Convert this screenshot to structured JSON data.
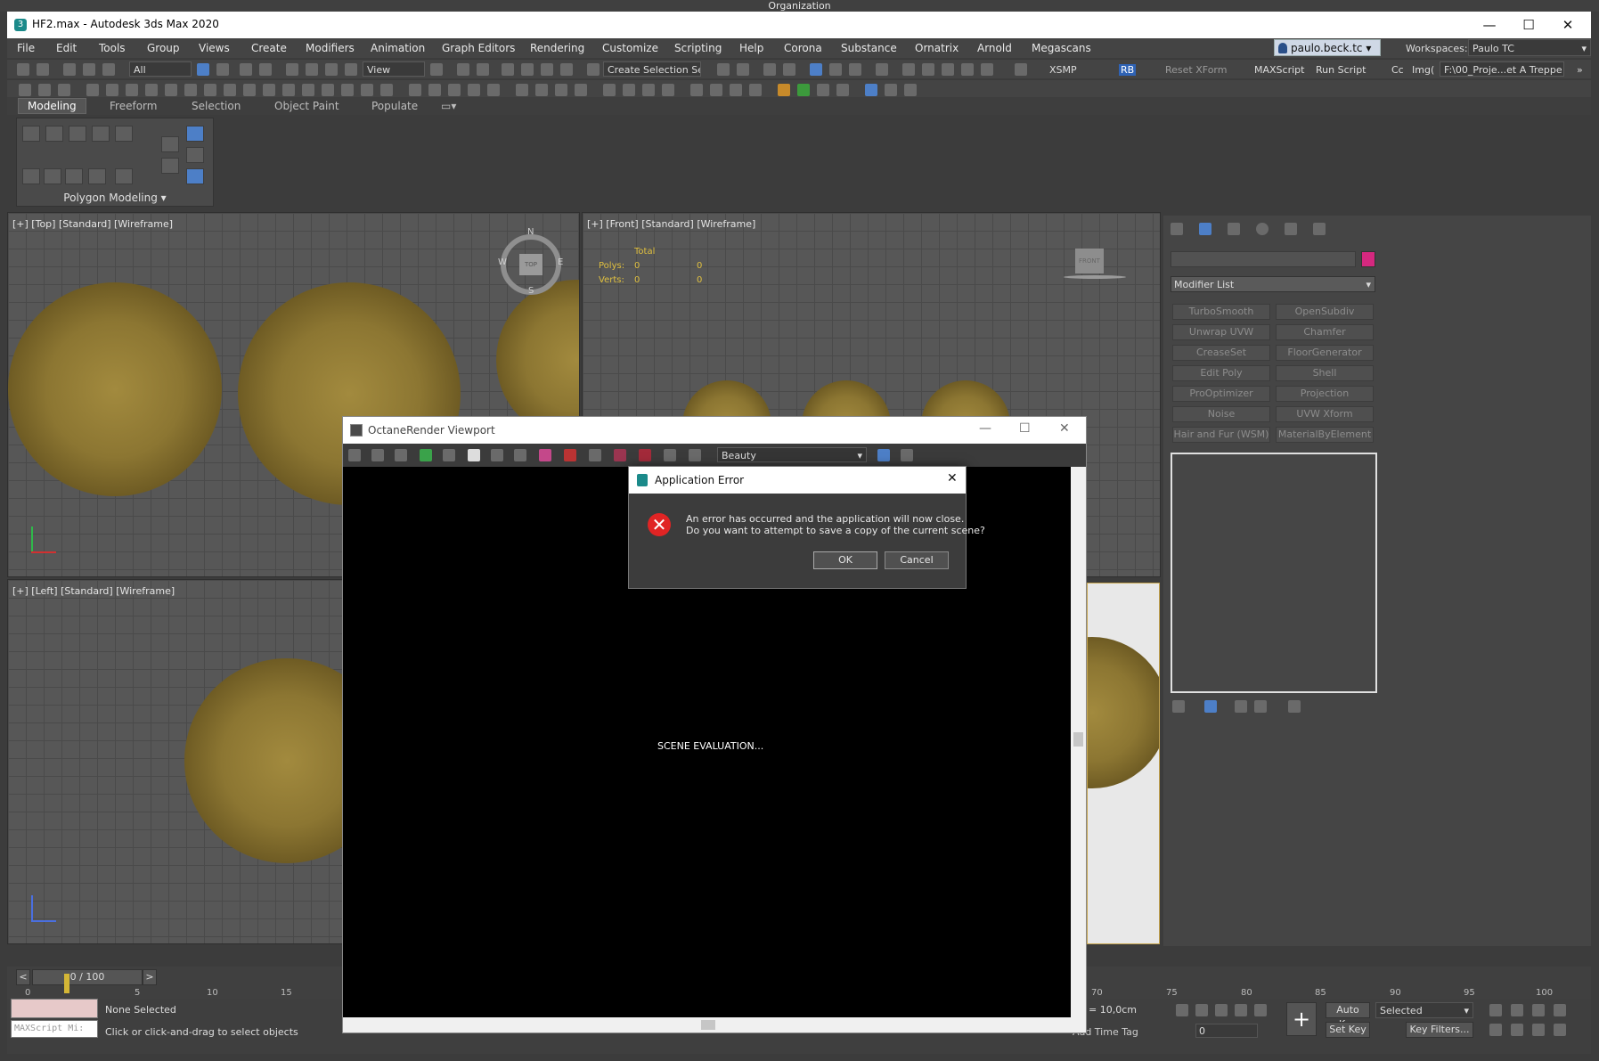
{
  "organization": "Organization",
  "window": {
    "title": "HF2.max - Autodesk 3ds Max 2020",
    "minimize": "—",
    "maximize": "☐",
    "close": "✕"
  },
  "menu": [
    "File",
    "Edit",
    "Tools",
    "Group",
    "Views",
    "Create",
    "Modifiers",
    "Animation",
    "Graph Editors",
    "Rendering",
    "Customize",
    "Scripting",
    "Help",
    "Corona",
    "Substance",
    "Ornatrix",
    "Arnold",
    "Megascans"
  ],
  "user": "paulo.beck.tc",
  "workspaces": {
    "label": "Workspaces:",
    "value": "Paulo TC"
  },
  "toolbar1": {
    "filter": "All",
    "view": "View",
    "selection_set": "Create Selection Se",
    "xsmp": "XSMP",
    "rb": "RB",
    "reset_xform": "Reset XForm",
    "maxscript": "MAXScript",
    "run_script": "Run Script",
    "cc": "Cc",
    "img": "Img(",
    "path": "F:\\00_Proje...et A Treppe"
  },
  "ribbon": {
    "tabs": [
      "Modeling",
      "Freeform",
      "Selection",
      "Object Paint",
      "Populate"
    ],
    "panel_label": "Polygon Modeling ▾"
  },
  "viewports": {
    "top": "[+] [Top] [Standard] [Wireframe]",
    "front": "[+] [Front] [Standard] [Wireframe]",
    "left": "[+] [Left] [Standard] [Wireframe]",
    "stats": {
      "total": "Total",
      "polys_label": "Polys:",
      "verts_label": "Verts:",
      "polys": "0",
      "verts": "0",
      "polys2": "0",
      "verts2": "0"
    },
    "compass": {
      "n": "N",
      "s": "S",
      "e": "E",
      "w": "W",
      "cube": "TOP"
    },
    "front_cube": "FRONT"
  },
  "command_panel": {
    "modifier_list": "Modifier List",
    "color": "#d5287f",
    "buttons": [
      [
        "TurboSmooth",
        "OpenSubdiv"
      ],
      [
        "Unwrap UVW",
        "Chamfer"
      ],
      [
        "CreaseSet",
        "FloorGenerator"
      ],
      [
        "Edit Poly",
        "Shell"
      ],
      [
        "ProOptimizer",
        "Projection"
      ],
      [
        "Noise",
        "UVW Xform"
      ],
      [
        "Hair and Fur (WSM)",
        "MaterialByElement"
      ]
    ]
  },
  "timeline": {
    "frame": "0 / 100",
    "ticks_left": [
      "0",
      "5",
      "10",
      "15"
    ],
    "ticks_right": [
      "70",
      "75",
      "80",
      "85",
      "90",
      "95",
      "100"
    ]
  },
  "status": {
    "maxscript": "MAXScript Mi:",
    "selection": "None Selected",
    "hint": "Click or click-and-drag to select objects",
    "grid": "= 10,0cm",
    "add_time_tag": "Add Time Tag",
    "auto_key": "Auto Key",
    "set_key": "Set Key",
    "key_mode": "Selected",
    "key_filters": "Key Filters...",
    "frame_value": "0"
  },
  "octane": {
    "title": "OctaneRender Viewport",
    "pass": "Beauty",
    "status": "SCENE EVALUATION..."
  },
  "error": {
    "title": "Application Error",
    "line1": "An error has occurred and the application will now close.",
    "line2": "Do you want to attempt to save a copy of the current scene?",
    "ok": "OK",
    "cancel": "Cancel"
  }
}
